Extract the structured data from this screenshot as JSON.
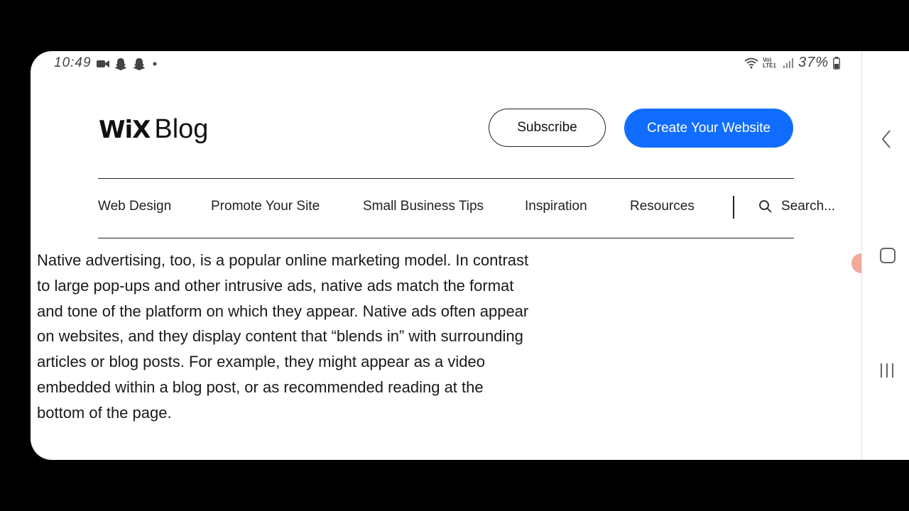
{
  "status_bar": {
    "time": "10:49",
    "battery_percent": "37%",
    "network_label": "Vo) LTE1"
  },
  "header": {
    "logo_mark": "WiX",
    "logo_text": "Blog",
    "subscribe_label": "Subscribe",
    "create_label": "Create Your Website"
  },
  "nav": {
    "items": [
      {
        "label": "Web Design"
      },
      {
        "label": "Promote Your Site"
      },
      {
        "label": "Small Business Tips"
      },
      {
        "label": "Inspiration"
      },
      {
        "label": "Resources"
      }
    ],
    "search_placeholder": "Search..."
  },
  "article": {
    "paragraph": "Native advertising, too, is a popular online marketing model. In contrast to large pop-ups and other intrusive ads, native ads match the format and tone of the platform on which they appear. Native ads often appear on websites, and they display content that “blends in” with surrounding articles or blog posts. For example, they might appear as a video embedded within a blog post, or as recommended reading at the bottom of the page."
  },
  "icons": {
    "status_left": [
      "video-camera-icon",
      "snapchat-icon",
      "snapchat-icon",
      "dot-icon"
    ],
    "status_right": [
      "wifi-icon",
      "signal-icon",
      "battery-icon"
    ],
    "search": "search-icon",
    "android_nav": [
      "back-icon",
      "home-icon",
      "recents-icon"
    ]
  },
  "colors": {
    "accent": "#116dff",
    "background": "#ffffff",
    "frame": "#000000",
    "text": "#1a1a1a"
  }
}
